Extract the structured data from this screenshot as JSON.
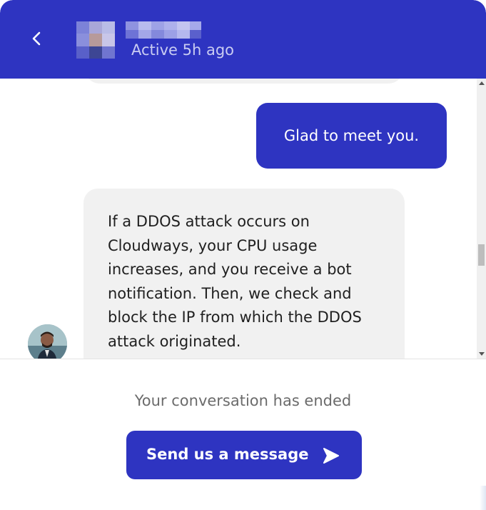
{
  "header": {
    "back_icon": "chevron-left-icon",
    "agent_name": "",
    "status": "Active 5h ago",
    "background_color": "#2e34c1"
  },
  "conversation": {
    "messages": [
      {
        "sender": "user",
        "text": "Glad to meet you."
      },
      {
        "sender": "agent",
        "lines": [
          "If a DDOS attack occurs on",
          "Cloudways, your CPU usage",
          "increases, and you receive a bot",
          "notification. Then, we check and",
          "block the IP from which the DDOS",
          "attack originated."
        ]
      }
    ],
    "bubble_colors": {
      "user": "#2e34c1",
      "agent": "#f1f1f1"
    }
  },
  "footer": {
    "ended_text": "Your conversation has ended",
    "send_button_label": "Send us a message",
    "send_icon": "send-arrow-icon"
  }
}
